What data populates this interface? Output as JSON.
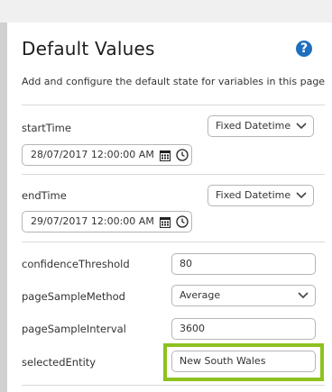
{
  "panel": {
    "title": "Default Values",
    "help_icon": "question-circle-icon",
    "help_glyph": "?",
    "subtitle": "Add and configure the default state for variables in this page"
  },
  "variables": {
    "startTime": {
      "label": "startTime",
      "mode": "Fixed Datetime",
      "value": "28/07/2017 12:00:00 AM"
    },
    "endTime": {
      "label": "endTime",
      "mode": "Fixed Datetime",
      "value": "29/07/2017 12:00:00 AM"
    },
    "confidenceThreshold": {
      "label": "confidenceThreshold",
      "value": "80"
    },
    "pageSampleMethod": {
      "label": "pageSampleMethod",
      "value": "Average"
    },
    "pageSampleInterval": {
      "label": "pageSampleInterval",
      "value": "3600"
    },
    "selectedEntity": {
      "label": "selectedEntity",
      "value": "New South Wales"
    }
  },
  "colors": {
    "accent_blue": "#1f6fbf",
    "highlight_green": "#8dc21f"
  }
}
